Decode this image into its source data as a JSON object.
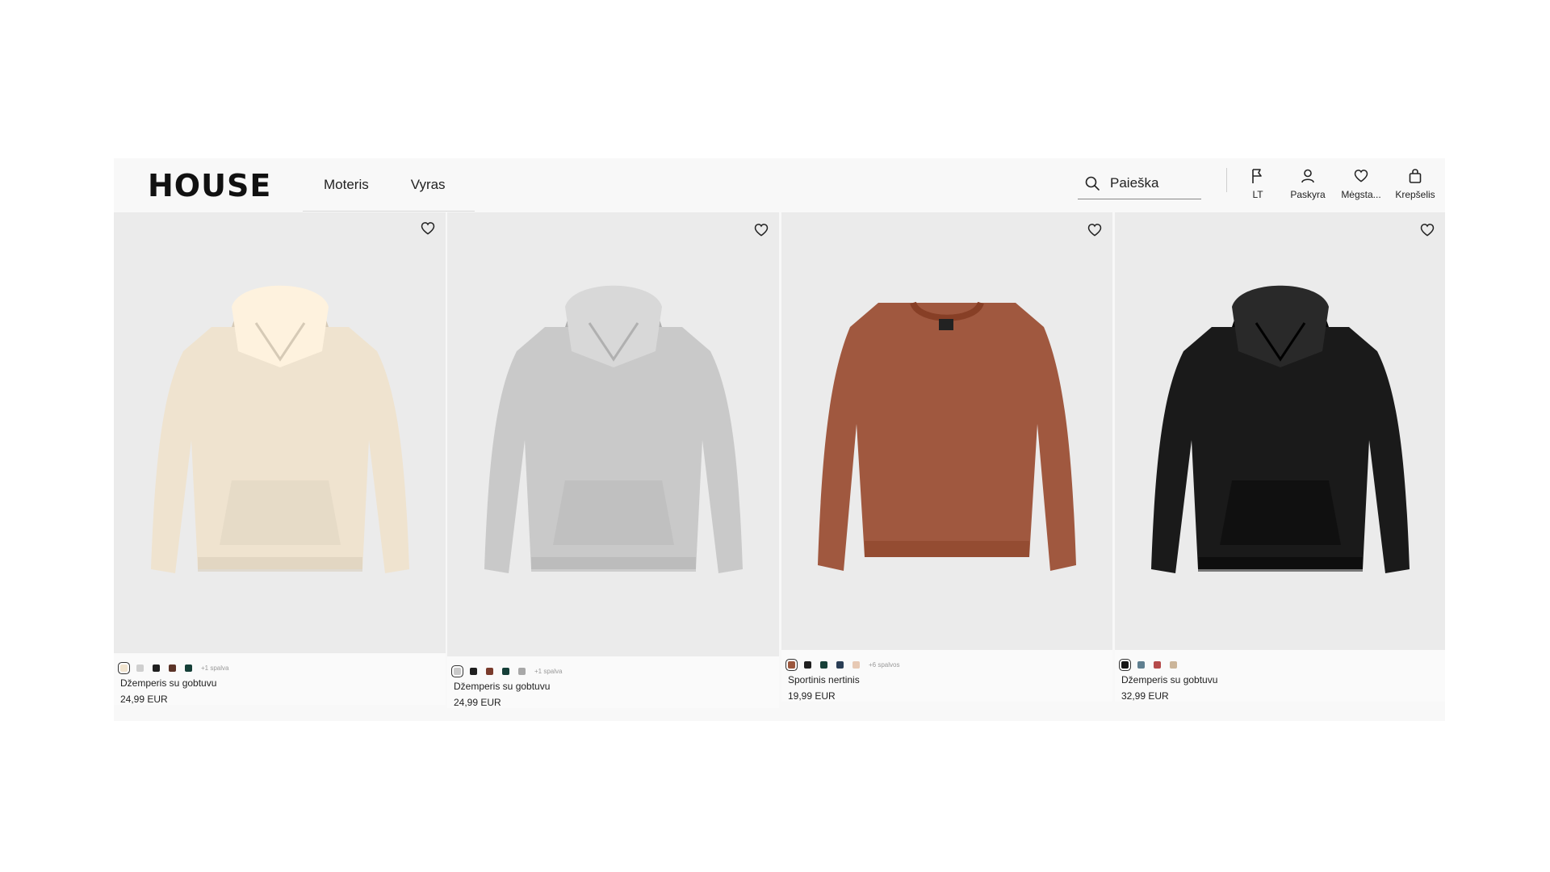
{
  "header": {
    "logo": "HOUSE",
    "nav": [
      "Moteris",
      "Vyras"
    ],
    "search_placeholder": "Paieška",
    "icons": [
      {
        "icon": "flag-icon",
        "label": "LT"
      },
      {
        "icon": "user-icon",
        "label": "Paskyra"
      },
      {
        "icon": "heart-icon",
        "label": "Mėgsta..."
      },
      {
        "icon": "bag-icon",
        "label": "Krepšelis"
      }
    ]
  },
  "products": [
    {
      "name": "Džemperis su gobtuvu",
      "price": "24,99 EUR",
      "more_colors": "+1 spalva",
      "garment": "hoodie",
      "garment_color": "#efe3cf",
      "swatches": [
        "#f1e4cf",
        "#cfcfcf",
        "#1f1f1f",
        "#5b3327",
        "#153f38"
      ]
    },
    {
      "name": "Džemperis su gobtuvu",
      "price": "24,99 EUR",
      "more_colors": "+1 spalva",
      "garment": "hoodie",
      "garment_color": "#c9c9c9",
      "swatches": [
        "#c9c9c9",
        "#1f1f1f",
        "#7a3b2c",
        "#153f38",
        "#a8a8a8"
      ]
    },
    {
      "name": "Sportinis nertinis",
      "price": "19,99 EUR",
      "more_colors": "+6 spalvos",
      "garment": "crewneck",
      "garment_color": "#a0583f",
      "swatches": [
        "#9b573e",
        "#1f1f1f",
        "#174038",
        "#2a3e55",
        "#e7c9b4"
      ]
    },
    {
      "name": "Džemperis su gobtuvu",
      "price": "32,99 EUR",
      "more_colors": "",
      "garment": "hoodie",
      "garment_color": "#1a1a1a",
      "swatches": [
        "#151515",
        "#5f7f90",
        "#b54a4a",
        "#cbb59a"
      ]
    }
  ]
}
